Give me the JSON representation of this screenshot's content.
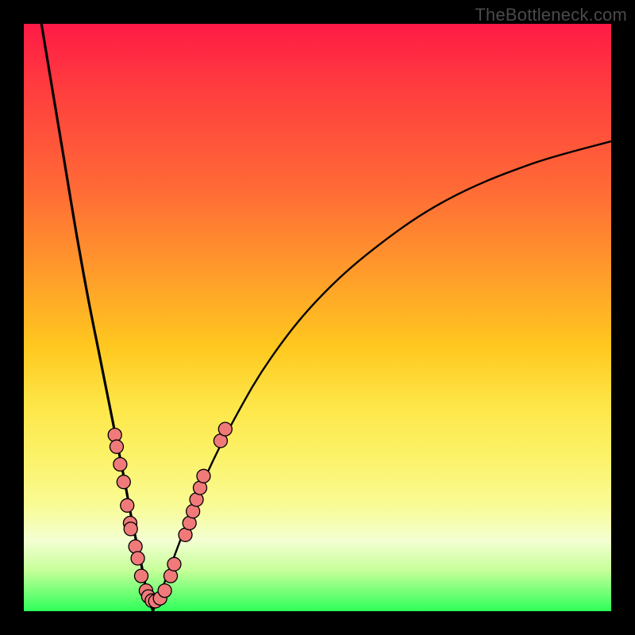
{
  "watermark": "TheBottleneck.com",
  "colors": {
    "frame": "#000000",
    "curve": "#000000",
    "dot_fill": "#f07a7a",
    "dot_stroke": "#000000",
    "gradient_top": "#ff1a46",
    "gradient_bottom": "#2eff5a"
  },
  "chart_data": {
    "type": "line",
    "title": "",
    "xlabel": "",
    "ylabel": "",
    "xlim": [
      0,
      100
    ],
    "ylim": [
      0,
      100
    ],
    "description": "Bottleneck-style V curve: percentage mismatch (y) vs. component balance (x). Minimum at x≈22 where y≈0. Left branch rises steeply to y≈100 at x≈3; right branch rises with diminishing slope to y≈80 at x≈100. Pink dots cluster along both branches near the valley (y roughly 2–32).",
    "series": [
      {
        "name": "left_branch",
        "x": [
          3,
          5,
          7,
          9,
          11,
          13,
          15,
          17,
          18.5,
          20,
          21,
          22
        ],
        "y": [
          100,
          88,
          76,
          64,
          53,
          43,
          33,
          23,
          15,
          8,
          3,
          0
        ]
      },
      {
        "name": "right_branch",
        "x": [
          22,
          24,
          27,
          31,
          36,
          42,
          50,
          60,
          72,
          86,
          100
        ],
        "y": [
          0,
          5,
          13,
          23,
          33,
          43,
          53,
          62,
          70,
          76,
          80
        ]
      }
    ],
    "dots": [
      {
        "x": 15.5,
        "y": 30
      },
      {
        "x": 15.8,
        "y": 28
      },
      {
        "x": 16.4,
        "y": 25
      },
      {
        "x": 17.0,
        "y": 22
      },
      {
        "x": 17.6,
        "y": 18
      },
      {
        "x": 18.1,
        "y": 15
      },
      {
        "x": 18.2,
        "y": 14
      },
      {
        "x": 19.0,
        "y": 11
      },
      {
        "x": 19.4,
        "y": 9
      },
      {
        "x": 20.0,
        "y": 6
      },
      {
        "x": 20.8,
        "y": 3.5
      },
      {
        "x": 21.2,
        "y": 2.5
      },
      {
        "x": 21.8,
        "y": 1.8
      },
      {
        "x": 22.4,
        "y": 1.7
      },
      {
        "x": 23.2,
        "y": 2.2
      },
      {
        "x": 24.0,
        "y": 3.5
      },
      {
        "x": 25.0,
        "y": 6
      },
      {
        "x": 25.6,
        "y": 8
      },
      {
        "x": 27.5,
        "y": 13
      },
      {
        "x": 28.2,
        "y": 15
      },
      {
        "x": 28.8,
        "y": 17
      },
      {
        "x": 29.4,
        "y": 19
      },
      {
        "x": 30.0,
        "y": 21
      },
      {
        "x": 30.6,
        "y": 23
      },
      {
        "x": 33.5,
        "y": 29
      },
      {
        "x": 34.3,
        "y": 31
      }
    ]
  }
}
